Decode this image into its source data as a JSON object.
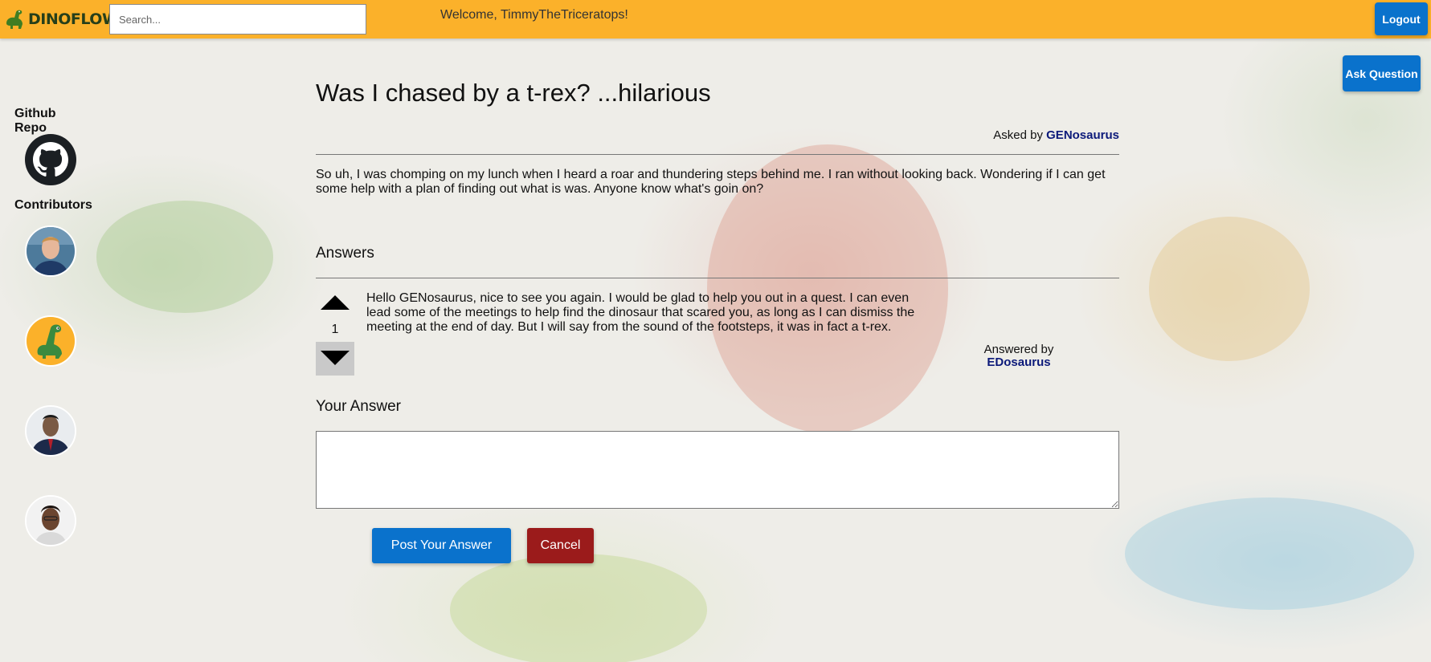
{
  "header": {
    "logo_text": "DINOFLOW",
    "search_placeholder": "Search...",
    "welcome_prefix": "Welcome, ",
    "username": "TimmyTheTriceratops",
    "welcome_suffix": "!",
    "logout_label": "Logout"
  },
  "ask_button_label": "Ask Question",
  "sidebar": {
    "github_heading": "Github Repo",
    "contributors_heading": "Contributors"
  },
  "question": {
    "title": "Was I chased by a t-rex? ...hilarious",
    "asked_by_label": "Asked by ",
    "author": "GENosaurus",
    "body": "So uh, I was chomping on my lunch when I heard a roar and thundering steps behind me. I ran without looking back. Wondering if I can get some help with a plan of finding out what is was. Anyone know what's goin on?"
  },
  "answers": {
    "heading": "Answers",
    "items": [
      {
        "votes": "1",
        "body": "Hello GENosaurus, nice to see you again. I would be glad to help you out in a quest. I can even lead some of the meetings to help find the dinosaur that scared you, as long as I can dismiss the meeting at the end of day. But I will say from the sound of the footsteps, it was in fact a t-rex.",
        "answered_by_label": "Answered by",
        "author": "EDosaurus"
      }
    ]
  },
  "your_answer": {
    "heading": "Your Answer",
    "value": "",
    "post_label": "Post Your Answer",
    "cancel_label": "Cancel"
  },
  "colors": {
    "header_bg": "#fbb12a",
    "primary_button": "#0a72cc",
    "cancel_button": "#9b1b1b",
    "user_link": "#0c1a7a"
  }
}
